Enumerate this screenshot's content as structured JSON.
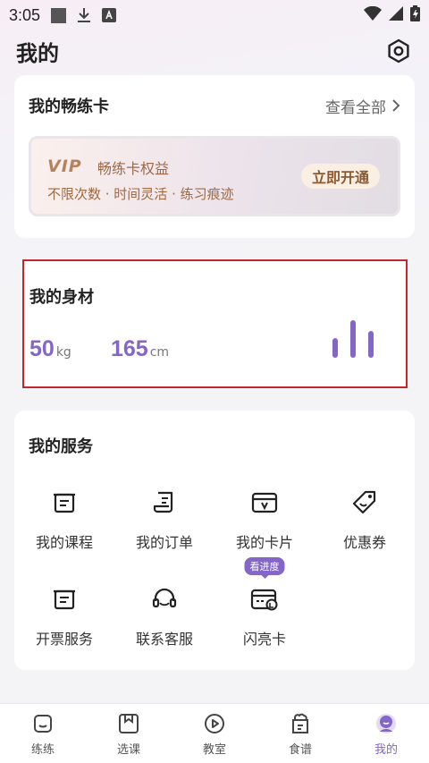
{
  "status_bar": {
    "time": "3:05"
  },
  "header": {
    "title": "我的"
  },
  "card_subscription": {
    "title": "我的畅练卡",
    "view_all": "查看全部",
    "vip": {
      "tag": "VIP",
      "title": "畅练卡权益",
      "subtitle": "不限次数 · 时间灵活 · 练习痕迹",
      "button": "立即开通"
    }
  },
  "body_card": {
    "title": "我的身材",
    "weight": {
      "value": "50",
      "unit": "kg"
    },
    "height": {
      "value": "165",
      "unit": "cm"
    }
  },
  "services": {
    "title": "我的服务",
    "items": [
      {
        "label": "我的课程",
        "icon": "course-icon"
      },
      {
        "label": "我的订单",
        "icon": "order-icon"
      },
      {
        "label": "我的卡片",
        "icon": "card-icon"
      },
      {
        "label": "优惠券",
        "icon": "coupon-icon"
      },
      {
        "label": "开票服务",
        "icon": "invoice-icon"
      },
      {
        "label": "联系客服",
        "icon": "headset-icon"
      },
      {
        "label": "闪亮卡",
        "icon": "shine-card-icon",
        "badge": "看进度"
      }
    ]
  },
  "bottom_nav": {
    "items": [
      {
        "label": "练练"
      },
      {
        "label": "选课"
      },
      {
        "label": "教室"
      },
      {
        "label": "食谱"
      },
      {
        "label": "我的"
      }
    ]
  },
  "colors": {
    "accent": "#8466c8",
    "highlight_border": "#c3262f",
    "vip_text": "#a0683f"
  }
}
